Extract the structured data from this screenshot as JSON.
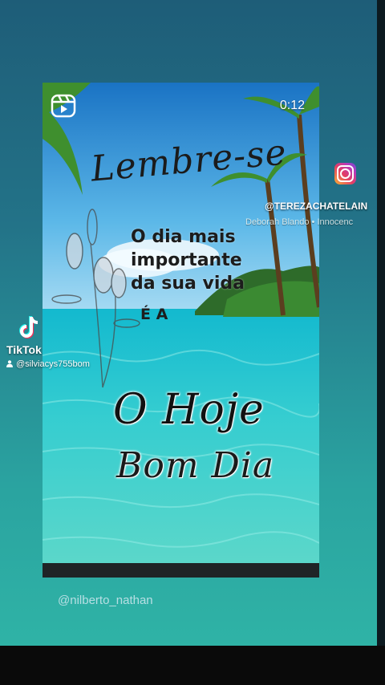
{
  "video": {
    "timer": "0:12",
    "script_top": "Lembre-se",
    "message_lines": [
      "O dia mais",
      "importante",
      "da sua vida"
    ],
    "message_end": "É A",
    "script_main": "O Hoje",
    "script_greeting": "Bom Dia"
  },
  "instagram": {
    "icon": "instagram-icon",
    "username": "@TEREZACHATELAIN",
    "song": "Deborah Blando • Innocenc"
  },
  "tiktok": {
    "icon": "tiktok-logo-icon",
    "label": "TikTok",
    "username": "@silviacys755bom"
  },
  "footer": {
    "username": "@nilberto_nathan"
  },
  "colors": {
    "teal_background": "#2aa3a0",
    "instagram_gradient_start": "#f9b233",
    "instagram_gradient_end": "#6b4ad8"
  }
}
